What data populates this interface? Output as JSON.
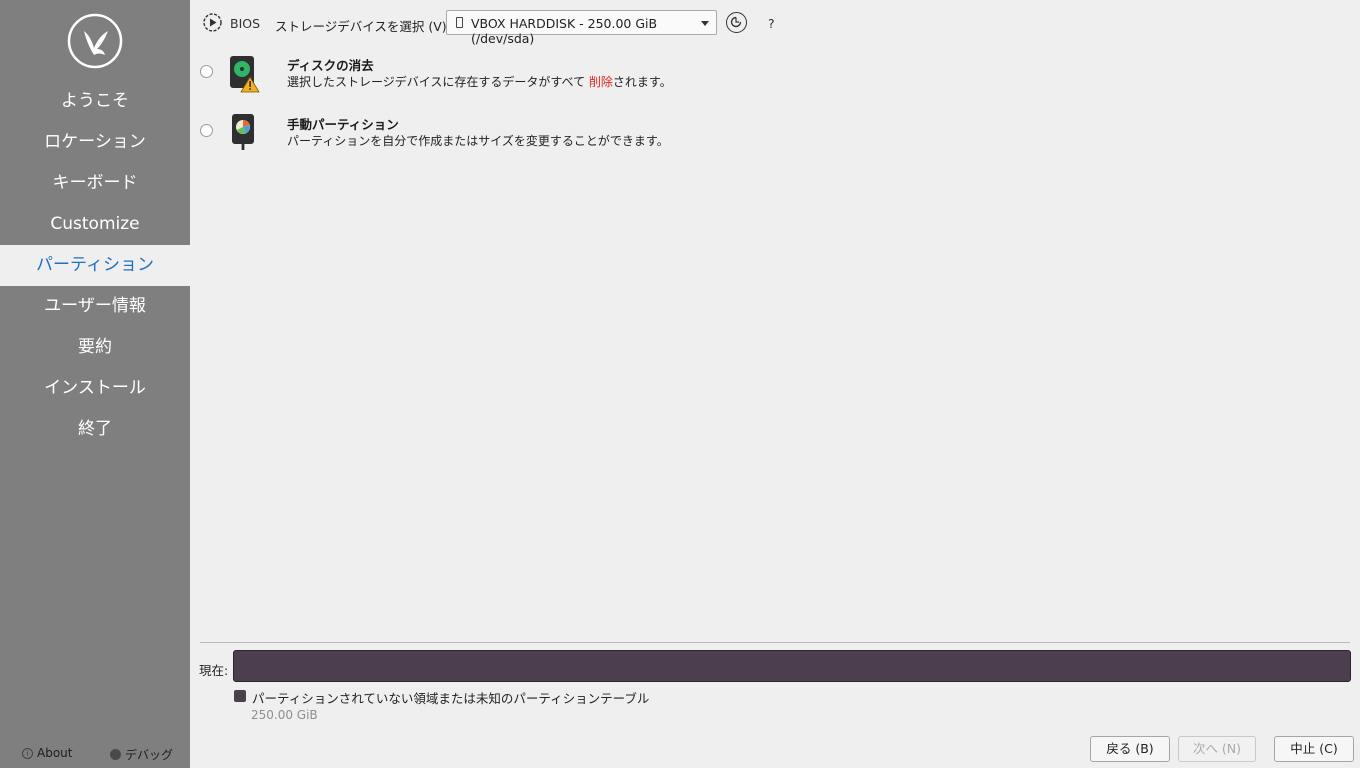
{
  "sidebar": {
    "items": [
      {
        "label": "ようこそ"
      },
      {
        "label": "ロケーション"
      },
      {
        "label": "キーボード"
      },
      {
        "label": "Customize"
      },
      {
        "label": "パーティション",
        "active": true
      },
      {
        "label": "ユーザー情報"
      },
      {
        "label": "要約"
      },
      {
        "label": "インストール"
      },
      {
        "label": "終了"
      }
    ],
    "footer": {
      "about": "About",
      "debug": "デバッグ"
    }
  },
  "topbar": {
    "bios_label": "BIOS",
    "storage_label": "ストレージデバイスを選択 (V):",
    "device_value": "VBOX HARDDISK - 250.00 GiB (/dev/sda)",
    "help": "?"
  },
  "options": [
    {
      "title": "ディスクの消去",
      "desc_before": "選択したストレージデバイスに存在するデータがすべて ",
      "desc_highlight": "削除",
      "desc_after": "されます。",
      "icon": "disk-erase-warning-icon"
    },
    {
      "title": "手動パーティション",
      "desc": "パーティションを自分で作成またはサイズを変更することができます。",
      "icon": "disk-manual-partition-icon"
    }
  ],
  "current": {
    "label": "現在:",
    "legend_label": "パーティションされていない領域または未知のパーティションテーブル",
    "legend_size": "250.00 GiB"
  },
  "buttons": {
    "back": "戻る (B)",
    "next": "次へ (N)",
    "cancel": "中止 (C)"
  },
  "colors": {
    "sidebar_bg": "#7f7f7f",
    "active_text": "#1f6fc5",
    "danger": "#e02424",
    "partition_bar": "#4c3f4d"
  }
}
